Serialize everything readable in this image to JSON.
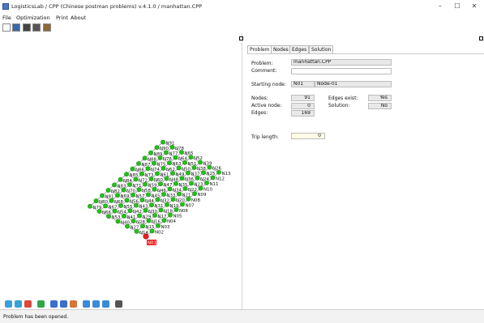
{
  "app": {
    "title": "LogisticsLab / CPP (Chinese postman problems) v.4.1.0 / manhattan.CPP",
    "window_controls": {
      "minimize": "–",
      "maximize": "☐",
      "close": "✕"
    }
  },
  "menu": {
    "file": "File",
    "optimization": "Optimization",
    "print": "Print",
    "about": "About"
  },
  "tabs": {
    "problem": "Problem",
    "nodes": "Nodes",
    "edges": "Edges",
    "solution": "Solution"
  },
  "form": {
    "problem_label": "Problem:",
    "problem_value": "manhattan.CPP",
    "comment_label": "Comment:",
    "comment_value": "",
    "starting_node_label": "Starting node:",
    "starting_node_id": "N01",
    "starting_node_name": "Node-01",
    "nodes_label": "Nodes:",
    "nodes_value": "91",
    "active_node_label": "Active node:",
    "active_node_value": "0",
    "edges_label": "Edges:",
    "edges_value": "169",
    "edges_exist_label": "Edges exist:",
    "edges_exist_value": "Yes",
    "solution_label": "Solution:",
    "solution_value": "No",
    "trip_length_label": "Trip length:",
    "trip_length_value": "0"
  },
  "status": {
    "text": "Problem has been opened."
  },
  "graph": {
    "node_color": "#22c21a",
    "active_node_color": "#ee1c1c",
    "label_visible": [
      "N01",
      "N02",
      "N03",
      "N04",
      "N05",
      "N06",
      "N07",
      "N08",
      "N09",
      "N10",
      "N11",
      "N12",
      "N13",
      "N14",
      "N15",
      "N16",
      "N17",
      "N18",
      "N19",
      "N20",
      "N21",
      "N22",
      "N23",
      "N24",
      "N25",
      "N26",
      "N27",
      "N28",
      "N29",
      "N30",
      "N31",
      "N32",
      "N33",
      "N34",
      "N35",
      "N36",
      "N37",
      "N38",
      "N39",
      "N40",
      "N41",
      "N42",
      "N43",
      "N44",
      "N45",
      "N46",
      "N47",
      "N48",
      "N49",
      "N50",
      "N51",
      "N52",
      "N53",
      "N54",
      "N55",
      "N56",
      "N57",
      "N58",
      "N59",
      "N60",
      "N61",
      "N62",
      "N63",
      "N64",
      "N65",
      "N66",
      "N67",
      "N68",
      "N69",
      "N70",
      "N71",
      "N72",
      "N73",
      "N74",
      "N75",
      "N76",
      "N77",
      "N78",
      "N79",
      "N80",
      "N81",
      "N82",
      "N83",
      "N84",
      "N85",
      "N86",
      "N87",
      "N88",
      "N89",
      "N90",
      "N91"
    ]
  }
}
